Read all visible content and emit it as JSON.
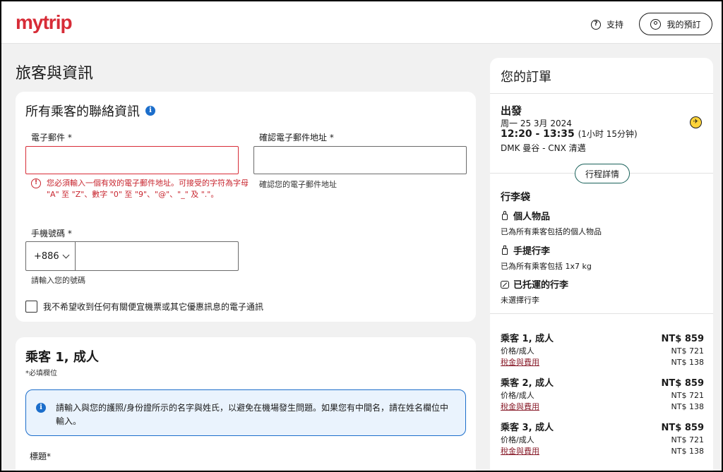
{
  "header": {
    "logo": "mytrip",
    "support_label": "支持",
    "my_booking_label": "我的預訂"
  },
  "page_title": "旅客與資訊",
  "contact": {
    "title": "所有乘客的聯絡資訊",
    "email_label": "電子郵件 *",
    "email_error": "您必須輸入一個有效的電子郵件地址。可接受的字符為字母 \"A\" 至 \"Z\"、數字 \"0\" 至 \"9\"、\"@\"、\"_\" 及 \".\"。",
    "confirm_email_label": "確認電子郵件地址 *",
    "confirm_email_help": "確認您的電子郵件地址",
    "phone_label": "手機號碼 *",
    "phone_code": "+886",
    "phone_help": "請輸入您的號碼",
    "optout_label": "我不希望收到任何有關便宜機票或其它優惠訊息的電子通訊"
  },
  "passenger": {
    "title": "乘客 1, 成人",
    "required_note": "*必填欄位",
    "notice": "請輸入與您的護照/身份證所示的名字與姓氏，以避免在機場發生問題。如果您有中間名，請在姓名欄位中輸入。",
    "title_label": "標題*"
  },
  "order": {
    "title": "您的訂單",
    "depart_heading": "出發",
    "depart_date": "周一 25 3月 2024",
    "depart_time": "12:20 - 13:35",
    "depart_duration": "(1小时 15分钟)",
    "route": "DMK 曼谷 - CNX 清邁",
    "details_button": "行程詳情",
    "baggage_heading": "行李袋",
    "baggage": [
      {
        "name": "個人物品",
        "desc": "已為所有乘客包括的個人物品",
        "icon": "personal-item-icon"
      },
      {
        "name": "手提行李",
        "desc": "已為所有乘客包括 1x7 kg",
        "icon": "carry-on-icon"
      },
      {
        "name": "已托運的行李",
        "desc": "未選擇行李",
        "icon": "checked-bag-icon"
      }
    ],
    "passengers": [
      {
        "label": "乘客 1, 成人",
        "total": "NT$ 859",
        "price_label": "价格/成人",
        "price": "NT$ 721",
        "tax_label": "稅金與費用",
        "tax": "NT$ 138"
      },
      {
        "label": "乘客 2, 成人",
        "total": "NT$ 859",
        "price_label": "价格/成人",
        "price": "NT$ 721",
        "tax_label": "稅金與費用",
        "tax": "NT$ 138"
      },
      {
        "label": "乘客 3, 成人",
        "total": "NT$ 859",
        "price_label": "价格/成人",
        "price": "NT$ 721",
        "tax_label": "稅金與費用",
        "tax": "NT$ 138"
      }
    ]
  },
  "colors": {
    "brand": "#d72c37",
    "info": "#1c6ecb",
    "error": "#c8262f"
  }
}
